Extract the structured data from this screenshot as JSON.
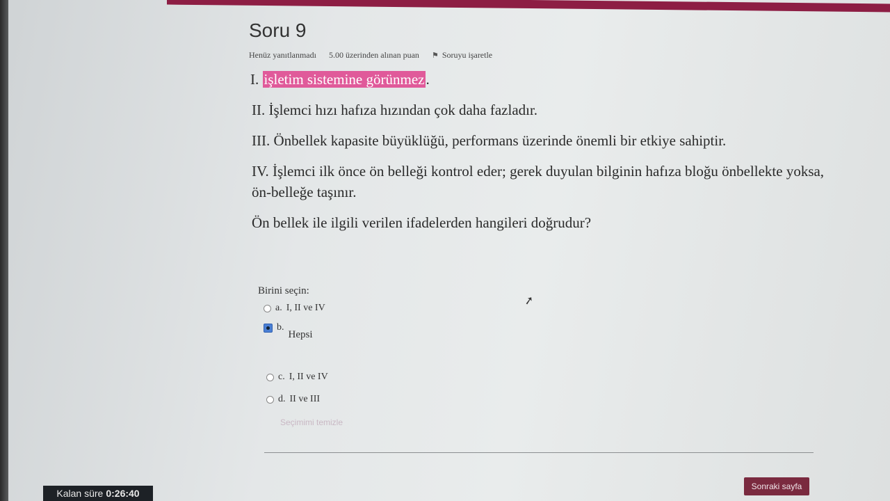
{
  "question": {
    "title": "Soru 9",
    "status": "Henüz yanıtlanmadı",
    "points": "5.00 üzerinden alınan puan",
    "flag_label": "Soruyu işaretle",
    "statements": {
      "s1_prefix": "I. ",
      "s1_highlight": "işletim sistemine görünmez",
      "s1_suffix": ".",
      "s2": "II. İşlemci hızı hafıza hızından çok daha fazladır.",
      "s3": "III. Önbellek kapasite büyüklüğü, performans üzerinde önemli bir etkiye sahiptir.",
      "s4": "IV. İşlemci ilk önce ön belleği kontrol eder; gerek duyulan bilginin hafıza bloğu önbellekte yoksa, ön-belleğe taşınır.",
      "q": "Ön bellek ile ilgili verilen ifadelerden hangileri doğrudur?"
    }
  },
  "answer": {
    "prompt": "Birini seçin:",
    "options": [
      {
        "letter": "a.",
        "text": "I, II ve IV",
        "selected": false
      },
      {
        "letter": "b.",
        "text": "Hepsi",
        "selected": true
      },
      {
        "letter": "c.",
        "text": "I, II ve IV",
        "selected": false
      },
      {
        "letter": "d.",
        "text": "II ve III",
        "selected": false
      }
    ],
    "clear_label": "Seçimimi temizle"
  },
  "footer": {
    "next_label": "Sonraki sayfa",
    "timer_label": "Kalan süre",
    "timer_value": "0:26:40"
  },
  "colors": {
    "accent": "#8d1e44",
    "highlight": "#e05a9a",
    "button": "#7a2a3f"
  }
}
